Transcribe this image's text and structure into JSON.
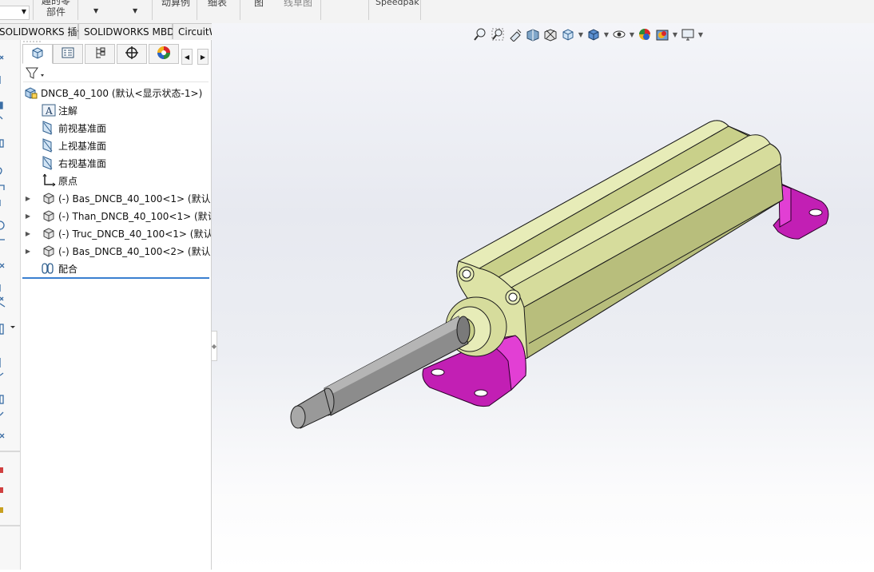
{
  "ribbon": {
    "groups": [
      {
        "label": "趣的零\n部件"
      },
      {
        "label": "动算例"
      },
      {
        "label": "细表"
      },
      {
        "label": "图"
      },
      {
        "label": "线草图"
      },
      {
        "label": "Speedpak"
      }
    ]
  },
  "tabs": [
    {
      "label": "SOLIDWORKS 插件"
    },
    {
      "label": "SOLIDWORKS MBD"
    },
    {
      "label": "CircuitWorks"
    }
  ],
  "feature_manager": {
    "tabs": [
      {
        "icon": "feature-manager-icon"
      },
      {
        "icon": "property-manager-icon"
      },
      {
        "icon": "configuration-manager-icon"
      },
      {
        "icon": "dimxpert-icon"
      },
      {
        "icon": "display-manager-icon"
      }
    ],
    "root": "DNCB_40_100  (默认<显示状态-1>)",
    "items": [
      {
        "label": "注解",
        "icon": "annotations-icon",
        "expandable": false
      },
      {
        "label": "前视基准面",
        "icon": "plane-icon",
        "expandable": false
      },
      {
        "label": "上视基准面",
        "icon": "plane-icon",
        "expandable": false
      },
      {
        "label": "右视基准面",
        "icon": "plane-icon",
        "expandable": false
      },
      {
        "label": "原点",
        "icon": "origin-icon",
        "expandable": false
      },
      {
        "label": "(-) Bas_DNCB_40_100<1> (默认<",
        "icon": "part-icon",
        "expandable": true
      },
      {
        "label": "(-) Than_DNCB_40_100<1> (默认",
        "icon": "part-icon",
        "expandable": true
      },
      {
        "label": "(-) Truc_DNCB_40_100<1> (默认-",
        "icon": "part-icon",
        "expandable": true
      },
      {
        "label": "(-) Bas_DNCB_40_100<2> (默认<",
        "icon": "part-icon",
        "expandable": true
      },
      {
        "label": "配合",
        "icon": "mates-icon",
        "expandable": false
      }
    ]
  },
  "hud": {
    "icons": [
      "zoom-to-fit-icon",
      "zoom-to-area-icon",
      "previous-view-icon",
      "section-view-icon",
      "dynamic-annotation-icon",
      "view-orientation-icon",
      "display-style-icon",
      "hide-show-items-icon",
      "edit-appearance-icon",
      "apply-scene-icon",
      "view-settings-icon"
    ]
  },
  "colors": {
    "cylinder_body": "#d6dc9c",
    "bracket": "#c21fb4",
    "rod": "#8c8c8c",
    "selection_line": "#3a7fd0"
  }
}
